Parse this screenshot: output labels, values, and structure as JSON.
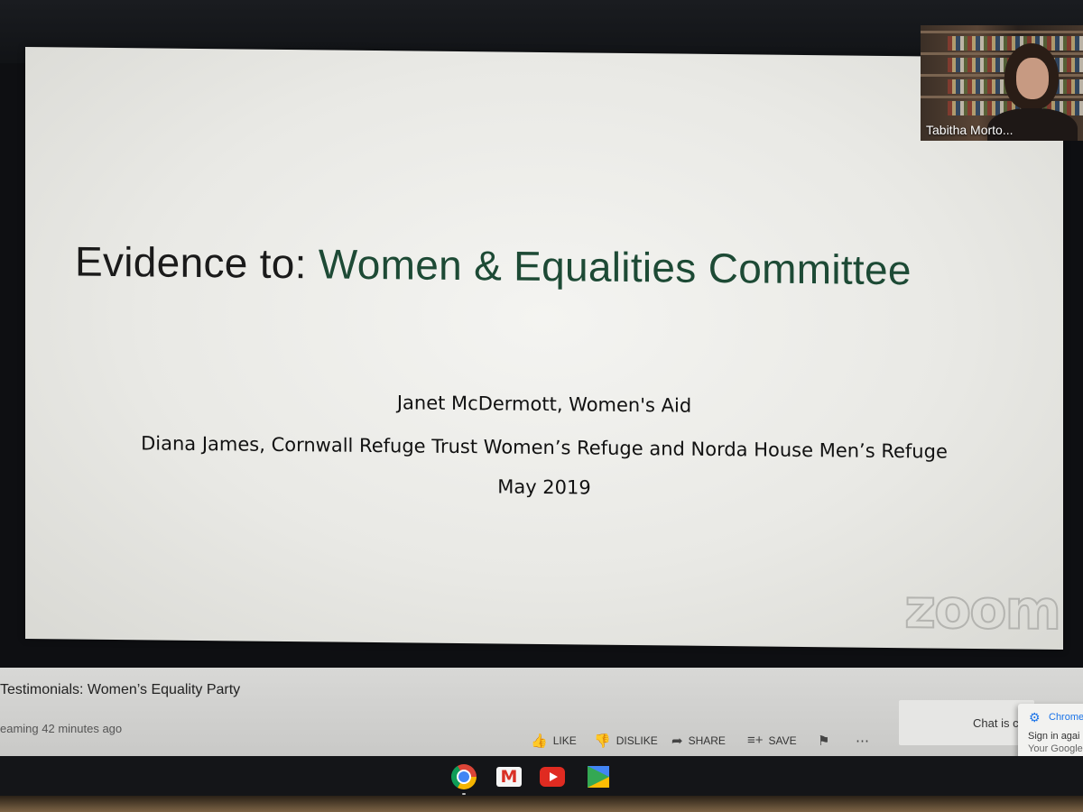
{
  "meeting": {
    "participant_name": "Tabitha Morto..."
  },
  "slide": {
    "title_prefix": "Evidence to:",
    "title_accent": "Women & Equalities Committee",
    "line1": "Janet McDermott, Women's Aid",
    "line2": "Diana James, Cornwall Refuge Trust Women’s Refuge and Norda House Men’s Refuge",
    "line3": "May 2019",
    "watermark": "zoom"
  },
  "video": {
    "title": "Testimonials: Women’s Equality Party",
    "status": "eaming 42 minutes ago",
    "actions": {
      "like": "LIKE",
      "dislike": "DISLIKE",
      "share": "SHARE",
      "save": "SAVE"
    },
    "chat_label": "Chat is c"
  },
  "chrome_popup": {
    "title": "Chrome",
    "line1": "Sign in agai",
    "line2": "Your Google"
  },
  "shelf": {
    "apps": [
      "chrome-icon",
      "gmail-icon",
      "youtube-icon",
      "play-store-icon"
    ]
  },
  "colors": {
    "title_accent": "#1d4a35",
    "youtube_red": "#e02b21",
    "chrome_blue": "#1a73e8"
  }
}
